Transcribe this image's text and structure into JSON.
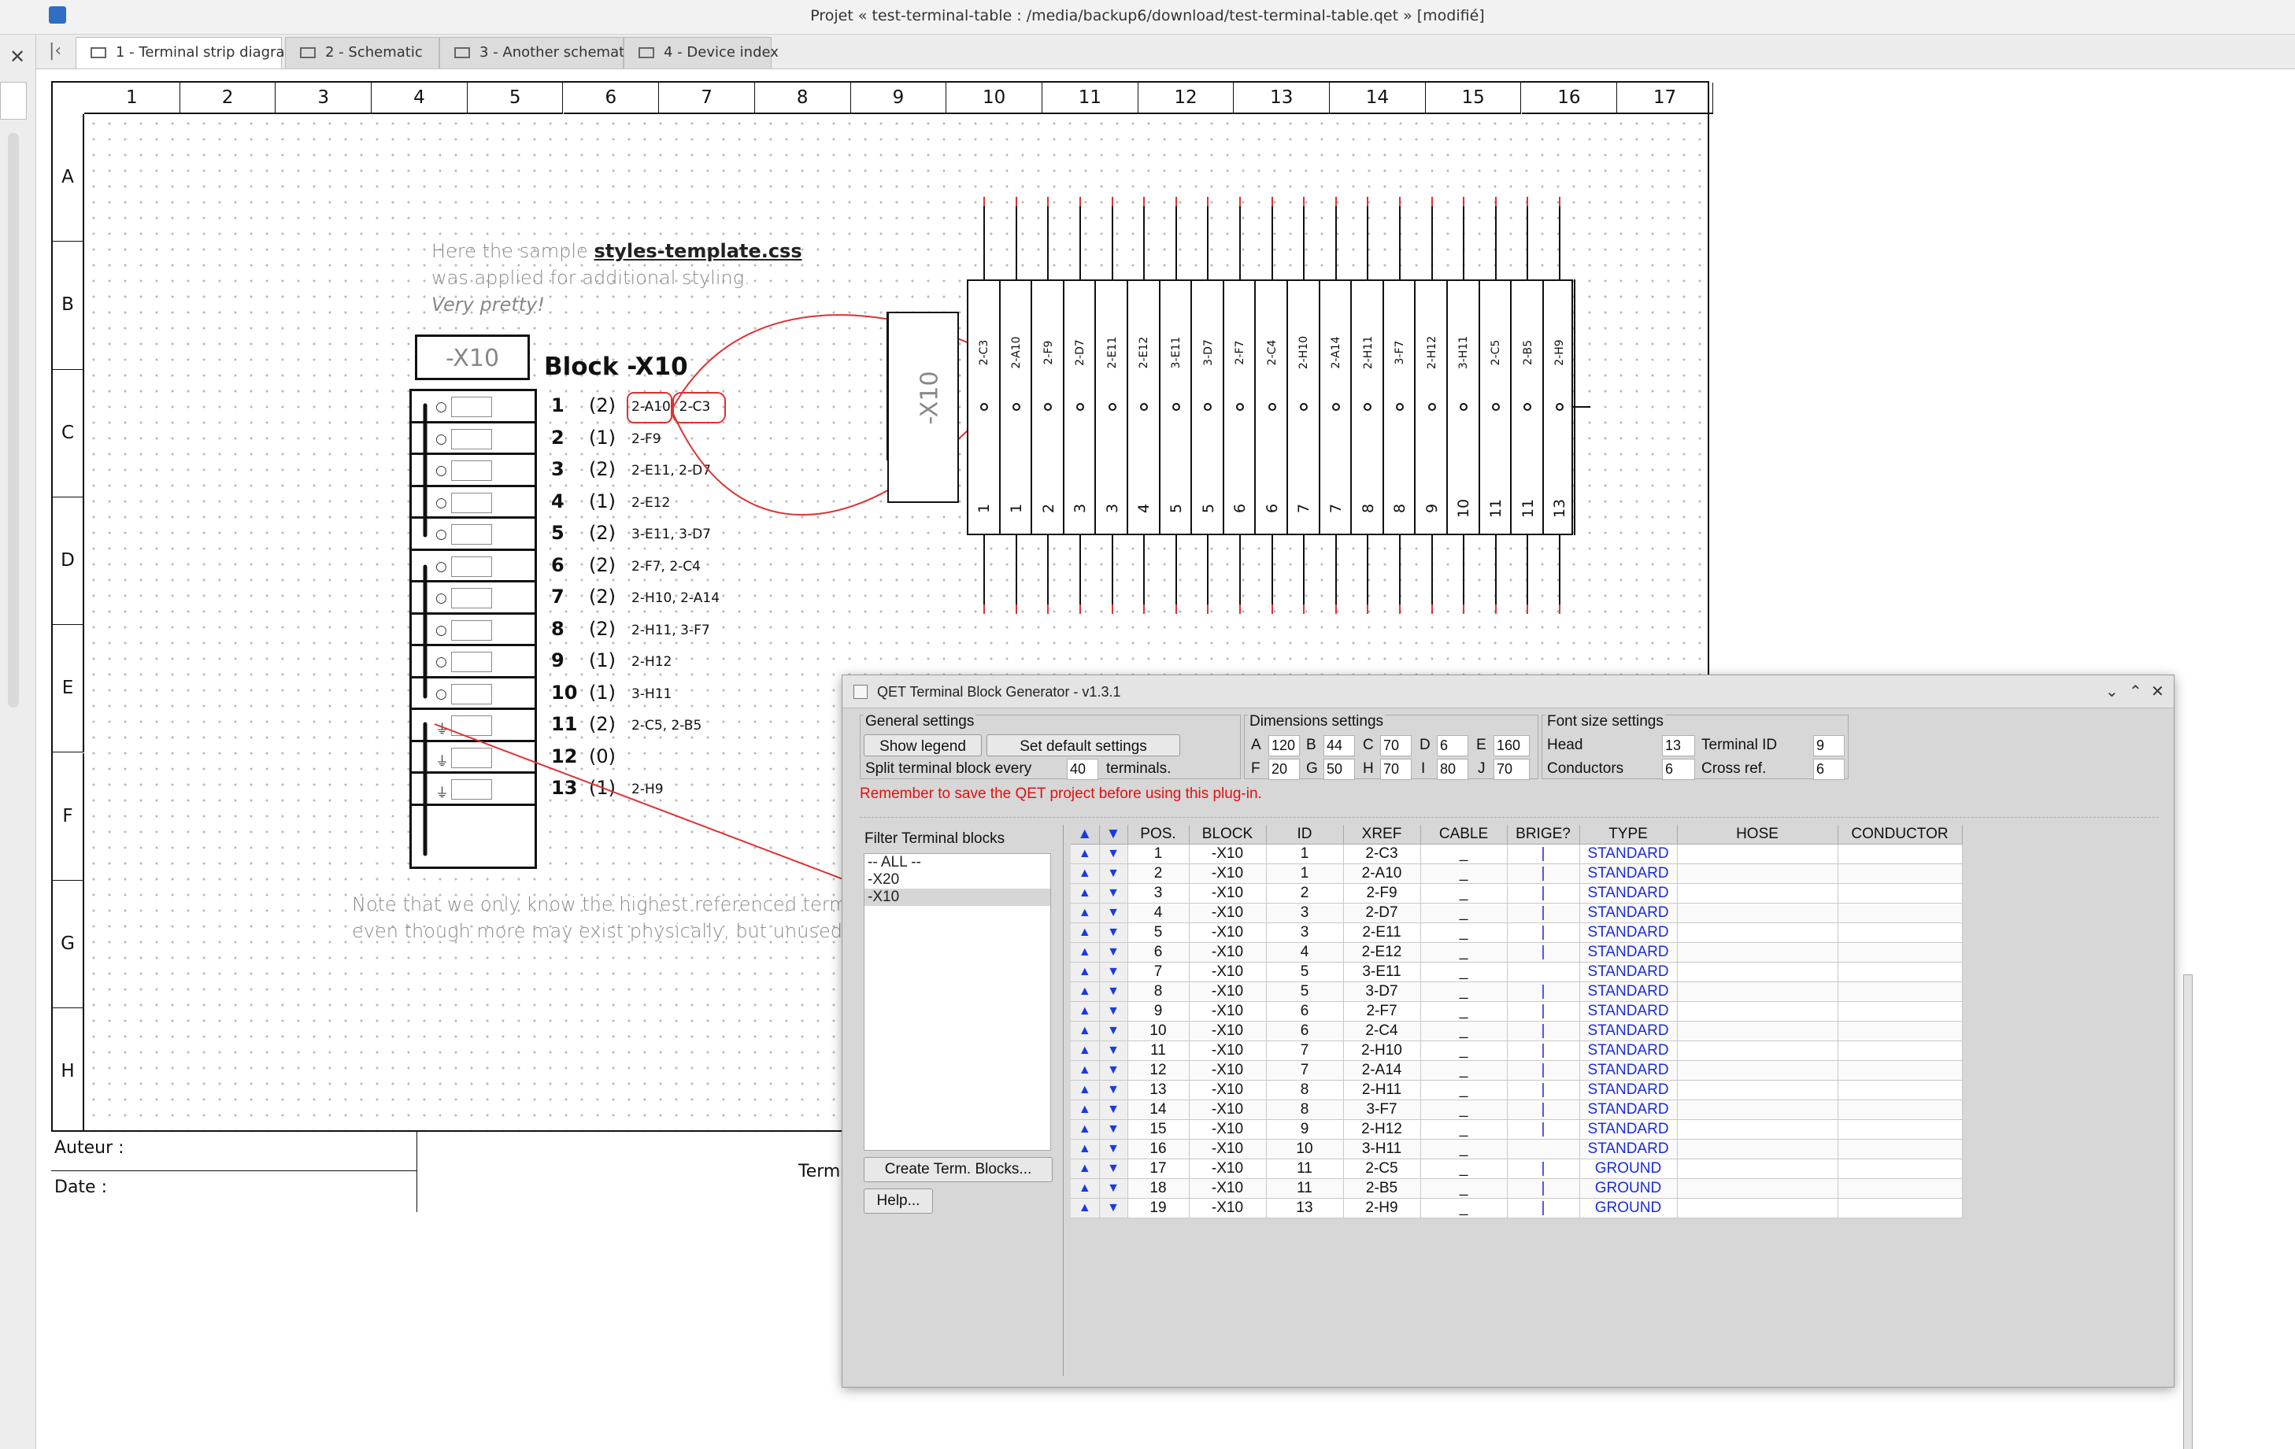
{
  "window": {
    "title": "Projet « test-terminal-table : /media/backup6/download/test-terminal-table.qet » [modifié]"
  },
  "tabs": [
    {
      "label": "1 - Terminal strip diagram"
    },
    {
      "label": "2 - Schematic"
    },
    {
      "label": "3 - Another schematic"
    },
    {
      "label": "4 - Device index"
    }
  ],
  "sheet": {
    "columns": [
      "1",
      "2",
      "3",
      "4",
      "5",
      "6",
      "7",
      "8",
      "9",
      "10",
      "11",
      "12",
      "13",
      "14",
      "15",
      "16",
      "17"
    ],
    "rows": [
      "A",
      "B",
      "C",
      "D",
      "E",
      "F",
      "G",
      "H"
    ],
    "note1_a": "Here the sample ",
    "note1_b": "styles-template.css",
    "note2": "was applied for additional styling.",
    "note3": "Very pretty!",
    "note4": "Note that we only know the highest referenced terminal nu",
    "note5": "even though more may exist physically, but unused.",
    "block_tag": "-X10",
    "block_title": "Block -X10",
    "terminals": [
      {
        "n": "1",
        "c": "(2)",
        "refs": "2-A10, 2-C3"
      },
      {
        "n": "2",
        "c": "(1)",
        "refs": "2-F9"
      },
      {
        "n": "3",
        "c": "(2)",
        "refs": "2-E11, 2-D7"
      },
      {
        "n": "4",
        "c": "(1)",
        "refs": "2-E12"
      },
      {
        "n": "5",
        "c": "(2)",
        "refs": "3-E11, 3-D7"
      },
      {
        "n": "6",
        "c": "(2)",
        "refs": "2-F7, 2-C4"
      },
      {
        "n": "7",
        "c": "(2)",
        "refs": "2-H10, 2-A14"
      },
      {
        "n": "8",
        "c": "(2)",
        "refs": "2-H11, 3-F7"
      },
      {
        "n": "9",
        "c": "(1)",
        "refs": "2-H12"
      },
      {
        "n": "10",
        "c": "(1)",
        "refs": "3-H11"
      },
      {
        "n": "11",
        "c": "(2)",
        "refs": "2-C5, 2-B5"
      },
      {
        "n": "12",
        "c": "(0)",
        "refs": ""
      },
      {
        "n": "13",
        "c": "(1)",
        "refs": "2-H9"
      }
    ],
    "strip_tag": "-X10",
    "strip_labels": [
      "2-C3",
      "2-A10",
      "2-F9",
      "2-D7",
      "2-E11",
      "2-E12",
      "3-E11",
      "3-D7",
      "2-F7",
      "2-C4",
      "2-H10",
      "2-A14",
      "2-H11",
      "3-F7",
      "2-H12",
      "3-H11",
      "2-C5",
      "2-B5",
      "2-H9"
    ],
    "strip_numbers": [
      "1",
      "1",
      "2",
      "3",
      "3",
      "4",
      "5",
      "5",
      "6",
      "6",
      "7",
      "7",
      "8",
      "8",
      "9",
      "10",
      "11",
      "11",
      "13"
    ],
    "titleblock": {
      "author": "Auteur :",
      "date": "Date :",
      "title_partial": "Termi"
    }
  },
  "dialog": {
    "title": "QET Terminal Block Generator - v1.3.1",
    "general": {
      "title": "General settings",
      "show_legend": "Show legend",
      "set_default": "Set default settings",
      "split_a": "Split terminal block every",
      "split_value": "40",
      "split_b": "terminals."
    },
    "dimensions": {
      "title": "Dimensions settings",
      "A": "120",
      "B": "44",
      "C": "70",
      "D": "6",
      "E": "160",
      "F": "20",
      "G": "50",
      "H": "70",
      "I": "80",
      "J": "70"
    },
    "fonts": {
      "title": "Font size settings",
      "head_label": "Head",
      "head": "13",
      "tid_label": "Terminal ID",
      "tid": "9",
      "cond_label": "Conductors",
      "cond": "6",
      "xref_label": "Cross ref.",
      "xref": "6"
    },
    "warning": "Remember to save the QET project before using this plug-in.",
    "filter_label": "Filter Terminal blocks",
    "filter_items": [
      "-- ALL --",
      "-X20",
      "-X10"
    ],
    "create_button": "Create Term. Blocks...",
    "help_button": "Help...",
    "table": {
      "headers": [
        "▲",
        "▼",
        "POS.",
        "BLOCK",
        "ID",
        "XREF",
        "CABLE",
        "BRIGE?",
        "TYPE",
        "HOSE",
        "CONDUCTOR"
      ],
      "rows": [
        [
          "1",
          "-X10",
          "1",
          "2-C3",
          "_",
          "|",
          "STANDARD"
        ],
        [
          "2",
          "-X10",
          "1",
          "2-A10",
          "_",
          "|",
          "STANDARD"
        ],
        [
          "3",
          "-X10",
          "2",
          "2-F9",
          "_",
          "|",
          "STANDARD"
        ],
        [
          "4",
          "-X10",
          "3",
          "2-D7",
          "_",
          "|",
          "STANDARD"
        ],
        [
          "5",
          "-X10",
          "3",
          "2-E11",
          "_",
          "|",
          "STANDARD"
        ],
        [
          "6",
          "-X10",
          "4",
          "2-E12",
          "_",
          "|",
          "STANDARD"
        ],
        [
          "7",
          "-X10",
          "5",
          "3-E11",
          "_",
          "",
          "STANDARD"
        ],
        [
          "8",
          "-X10",
          "5",
          "3-D7",
          "_",
          "|",
          "STANDARD"
        ],
        [
          "9",
          "-X10",
          "6",
          "2-F7",
          "_",
          "|",
          "STANDARD"
        ],
        [
          "10",
          "-X10",
          "6",
          "2-C4",
          "_",
          "|",
          "STANDARD"
        ],
        [
          "11",
          "-X10",
          "7",
          "2-H10",
          "_",
          "|",
          "STANDARD"
        ],
        [
          "12",
          "-X10",
          "7",
          "2-A14",
          "_",
          "|",
          "STANDARD"
        ],
        [
          "13",
          "-X10",
          "8",
          "2-H11",
          "_",
          "|",
          "STANDARD"
        ],
        [
          "14",
          "-X10",
          "8",
          "3-F7",
          "_",
          "|",
          "STANDARD"
        ],
        [
          "15",
          "-X10",
          "9",
          "2-H12",
          "_",
          "|",
          "STANDARD"
        ],
        [
          "16",
          "-X10",
          "10",
          "3-H11",
          "_",
          "",
          "STANDARD"
        ],
        [
          "17",
          "-X10",
          "11",
          "2-C5",
          "_",
          "|",
          "GROUND"
        ],
        [
          "18",
          "-X10",
          "11",
          "2-B5",
          "_",
          "|",
          "GROUND"
        ],
        [
          "19",
          "-X10",
          "13",
          "2-H9",
          "_",
          "|",
          "GROUND"
        ]
      ]
    }
  },
  "colors": {
    "annotation_red": "#e03030",
    "link_blue": "#1a2bdc",
    "warning_red": "#e01010"
  }
}
